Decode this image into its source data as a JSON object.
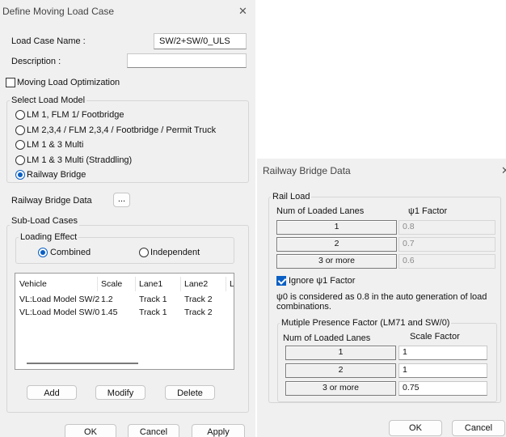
{
  "left_dialog": {
    "title": "Define Moving Load Case",
    "close_glyph": "✕",
    "load_case_name_label": "Load Case Name  :",
    "load_case_name_value": "SW/2+SW/0_ULS",
    "description_label": "Description :",
    "description_value": "",
    "optimization_label": "Moving Load Optimization",
    "optimization_checked": false,
    "select_load_model_title": "Select Load Model",
    "load_models": [
      {
        "label": "LM 1, FLM 1/ Footbridge",
        "selected": false
      },
      {
        "label": "LM 2,3,4 / FLM 2,3,4 / Footbridge / Permit Truck",
        "selected": false
      },
      {
        "label": "LM 1 & 3 Multi",
        "selected": false
      },
      {
        "label": "LM 1 & 3 Multi (Straddling)",
        "selected": false
      },
      {
        "label": "Railway Bridge",
        "selected": true
      }
    ],
    "railway_bridge_data_label": "Railway Bridge Data",
    "ellipsis_label": "...",
    "sub_load_cases_title": "Sub-Load Cases",
    "loading_effect_title": "Loading Effect",
    "combined_label": "Combined",
    "independent_label": "Independent",
    "table": {
      "headers": [
        "Vehicle",
        "Scale",
        "Lane1",
        "Lane2",
        "L"
      ],
      "rows": [
        [
          "VL:Load Model SW/2",
          "1.2",
          "Track 1",
          "Track 2"
        ],
        [
          "VL:Load Model SW/0",
          "1.45",
          "Track 1",
          "Track 2"
        ]
      ]
    },
    "add_label": "Add",
    "modify_label": "Modify",
    "delete_label": "Delete",
    "ok_label": "OK",
    "cancel_label": "Cancel",
    "apply_label": "Apply"
  },
  "right_dialog": {
    "title": "Railway Bridge Data",
    "close_glyph": "✕",
    "rail_load_title": "Rail Load",
    "num_lanes_header": "Num of Loaded Lanes",
    "psi_header": "ψ1 Factor",
    "rail_rows": [
      {
        "lanes": "1",
        "factor": "0.8"
      },
      {
        "lanes": "2",
        "factor": "0.7"
      },
      {
        "lanes": "3 or more",
        "factor": "0.6"
      }
    ],
    "ignore_label": "Ignore ψ1 Factor",
    "ignore_checked": true,
    "note_text": "ψ0 is considered as 0.8 in the auto generation of load combinations.",
    "mpf_title": "Mutiple Presence Factor (LM71 and SW/0)",
    "mpf_lanes_header": "Num of Loaded Lanes",
    "scale_header": "Scale Factor",
    "mpf_rows": [
      {
        "lanes": "1",
        "factor": "1"
      },
      {
        "lanes": "2",
        "factor": "1"
      },
      {
        "lanes": "3 or more",
        "factor": "0.75"
      }
    ],
    "ok_label": "OK",
    "cancel_label": "Cancel"
  }
}
